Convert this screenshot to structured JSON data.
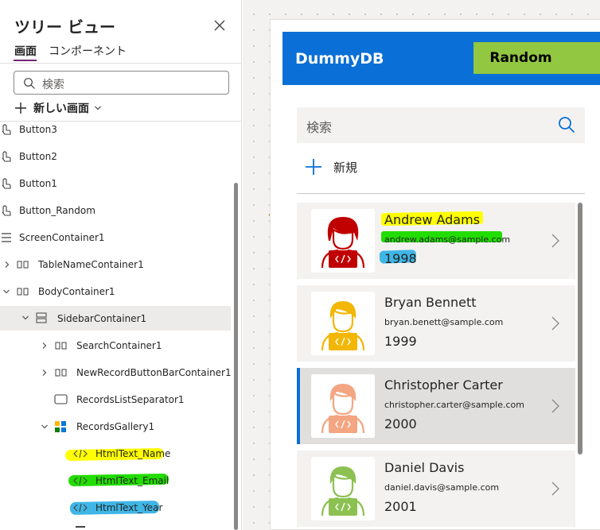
{
  "tree_panel": {
    "title": "ツリー ビュー",
    "tabs": [
      "画面",
      "コンポーネント"
    ],
    "search_placeholder": "検索",
    "new_screen_label": "新しい画面",
    "items": [
      {
        "label": "Button3",
        "icon": "button-icon"
      },
      {
        "label": "Button2",
        "icon": "button-icon"
      },
      {
        "label": "Button1",
        "icon": "button-icon"
      },
      {
        "label": "Button_Random",
        "icon": "button-icon"
      },
      {
        "label": "ScreenContainer1",
        "icon": "vertical-container-icon"
      },
      {
        "label": "TableNameContainer1",
        "icon": "horizontal-container-icon"
      },
      {
        "label": "BodyContainer1",
        "icon": "horizontal-container-icon"
      },
      {
        "label": "SidebarContainer1",
        "icon": "vertical-container-icon"
      },
      {
        "label": "SearchContainer1",
        "icon": "horizontal-container-icon"
      },
      {
        "label": "NewRecordButtonBarContainer1",
        "icon": "horizontal-container-icon"
      },
      {
        "label": "RecordsListSeparator1",
        "icon": "rectangle-icon"
      },
      {
        "label": "RecordsGallery1",
        "icon": "gallery-icon"
      },
      {
        "label": "HtmlText_Name",
        "icon": "html-text-icon"
      },
      {
        "label": "HtmlText_Email",
        "icon": "html-text-icon"
      },
      {
        "label": "HtmlText_Year",
        "icon": "html-text-icon"
      }
    ]
  },
  "app": {
    "title": "DummyDB",
    "random_button": "Random",
    "search_placeholder": "検索",
    "new_record_label": "新規",
    "records": [
      {
        "name": "Andrew Adams",
        "email": "andrew.adams@sample.com",
        "year": "1998",
        "avatar_color": "#c00000"
      },
      {
        "name": "Bryan Bennett",
        "email": "bryan.benett@sample.com",
        "year": "1999",
        "avatar_color": "#f2b705"
      },
      {
        "name": "Christopher Carter",
        "email": "christopher.carter@sample.com",
        "year": "2000",
        "avatar_color": "#f4a582"
      },
      {
        "name": "Daniel Davis",
        "email": "daniel.davis@sample.com",
        "year": "2001",
        "avatar_color": "#8cc152"
      }
    ]
  },
  "colors": {
    "header_blue": "#0a6fd6",
    "random_green": "#92c741",
    "highlight_yellow": "#ffff00",
    "highlight_green": "#22dd00",
    "highlight_cyan": "#3fb6e6",
    "tab_accent": "#742774"
  }
}
